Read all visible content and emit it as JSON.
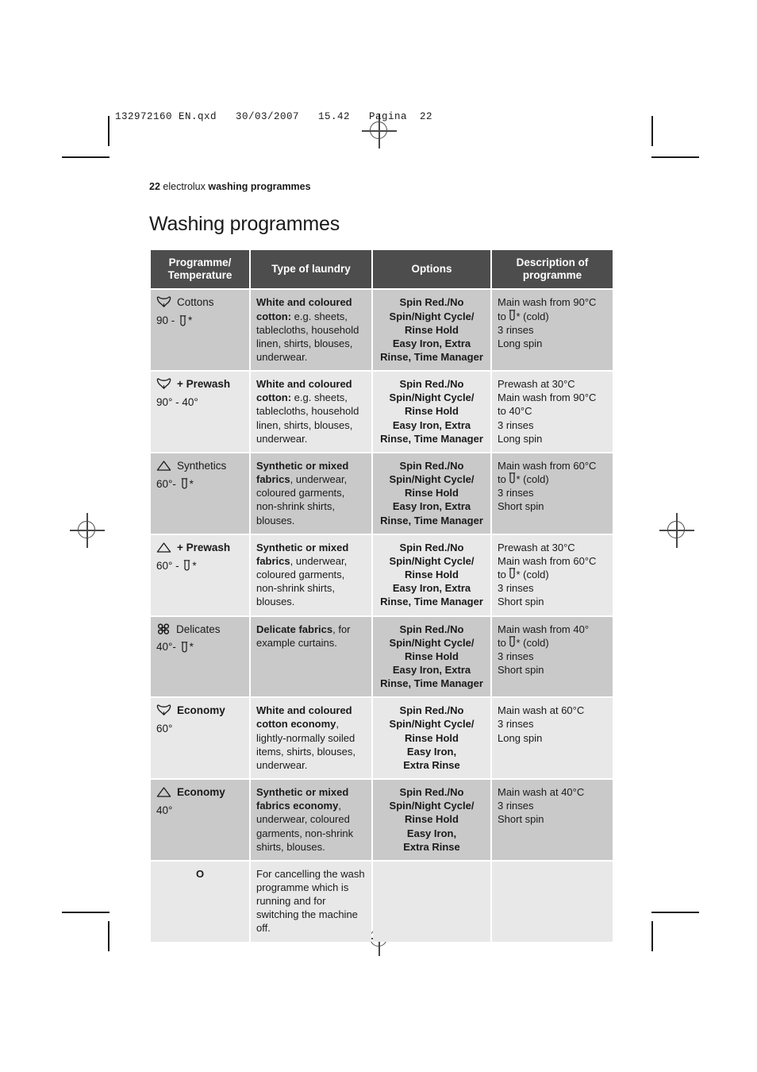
{
  "prepress": {
    "file_info": "132972160 EN.qxd   30/03/2007   15.42   Pagina  22"
  },
  "running_head": {
    "page_number": "22",
    "brand": "electrolux",
    "section": "washing programmes"
  },
  "page_title": "Washing programmes",
  "table": {
    "headers": [
      "Programme/\nTemperature",
      "Type of laundry",
      "Options",
      "Description of\nprogramme"
    ],
    "header_lines": {
      "col1_line1": "Programme/",
      "col1_line2": "Temperature",
      "col2": "Type of laundry",
      "col3": "Options",
      "col4_line1": "Description of",
      "col4_line2": "programme"
    },
    "rows": [
      {
        "shade": "dark",
        "icon": "cotton-icon",
        "programme": "Cottons",
        "programme_bold": false,
        "temperature_prefix": "90 - ",
        "temperature_icon": "thermometer-icon",
        "temperature_suffix": "*",
        "laundry_bold": "White and coloured cotton:",
        "laundry_rest": " e.g. sheets, tablecloths, household linen, shirts, blouses, underwear.",
        "options": "Spin Red./No Spin/Night Cycle/ Rinse Hold Easy Iron, Extra Rinse, Time Manager",
        "options_lines": [
          "Spin Red./No",
          "Spin/Night Cycle/",
          "Rinse Hold",
          "Easy Iron, Extra",
          "Rinse, Time Manager"
        ],
        "description_lines": [
          "Main wash from 90°C",
          "to [therm]* (cold)",
          "3 rinses",
          "Long spin"
        ],
        "desc_pre": "Main wash from 90°C",
        "desc_to_prefix": "to ",
        "desc_to_suffix": "* (cold)",
        "desc_tail": [
          "3 rinses",
          "Long spin"
        ]
      },
      {
        "shade": "light",
        "icon": "cotton-icon",
        "programme": "+ Prewash",
        "programme_bold": true,
        "temperature_prefix": "90° - 40°",
        "temperature_icon": "none",
        "temperature_suffix": "",
        "laundry_bold": "White and coloured cotton:",
        "laundry_rest": " e.g. sheets, tablecloths, household linen, shirts, blouses, underwear.",
        "options_lines": [
          "Spin Red./No",
          "Spin/Night Cycle/",
          "Rinse Hold",
          "Easy Iron, Extra",
          "Rinse, Time Manager"
        ],
        "desc_pre": "Prewash at 30°C\nMain wash from 90°C\nto 40°C",
        "desc_to_prefix": "",
        "desc_to_suffix": "",
        "desc_tail": [
          "3 rinses",
          "Long spin"
        ]
      },
      {
        "shade": "dark",
        "icon": "synthetics-icon",
        "programme": "Synthetics",
        "programme_bold": false,
        "temperature_prefix": "60°- ",
        "temperature_icon": "thermometer-icon",
        "temperature_suffix": "*",
        "laundry_bold": "Synthetic or mixed fabrics",
        "laundry_rest": ", underwear, coloured garments, non-shrink shirts, blouses.",
        "options_lines": [
          "Spin Red./No",
          "Spin/Night Cycle/",
          "Rinse Hold",
          "Easy Iron, Extra",
          "Rinse, Time Manager"
        ],
        "desc_pre": "Main wash from 60°C",
        "desc_to_prefix": "to ",
        "desc_to_suffix": "* (cold)",
        "desc_tail": [
          "3 rinses",
          "Short spin"
        ]
      },
      {
        "shade": "light",
        "icon": "synthetics-icon",
        "programme": "+ Prewash",
        "programme_bold": true,
        "temperature_prefix": "60° - ",
        "temperature_icon": "thermometer-icon",
        "temperature_suffix": "*",
        "laundry_bold": "Synthetic or mixed fabrics",
        "laundry_rest": ", underwear, coloured garments, non-shrink shirts, blouses.",
        "options_lines": [
          "Spin Red./No",
          "Spin/Night Cycle/",
          "Rinse Hold",
          "Easy Iron, Extra",
          "Rinse, Time Manager"
        ],
        "desc_pre": "Prewash at 30°C\nMain wash from 60°C",
        "desc_to_prefix": "to ",
        "desc_to_suffix": "* (cold)",
        "desc_tail": [
          "3 rinses",
          "Short spin"
        ]
      },
      {
        "shade": "dark",
        "icon": "delicates-icon",
        "programme": "Delicates",
        "programme_bold": false,
        "temperature_prefix": "40°- ",
        "temperature_icon": "thermometer-icon",
        "temperature_suffix": "*",
        "laundry_bold": "Delicate fabrics",
        "laundry_rest": ", for example curtains.",
        "options_lines": [
          "Spin Red./No",
          "Spin/Night Cycle/",
          "Rinse Hold",
          "Easy Iron, Extra",
          "Rinse, Time Manager"
        ],
        "desc_pre": "Main wash from 40°",
        "desc_to_prefix": "to ",
        "desc_to_suffix": "* (cold)",
        "desc_tail": [
          "3 rinses",
          "Short spin"
        ]
      },
      {
        "shade": "light",
        "icon": "cotton-icon",
        "programme": "Economy",
        "programme_bold": true,
        "temperature_prefix": "60°",
        "temperature_icon": "none",
        "temperature_suffix": "",
        "laundry_bold": "White and coloured cotton economy",
        "laundry_rest": ", lightly-normally soiled items, shirts, blouses, underwear.",
        "options_lines": [
          "Spin Red./No",
          "Spin/Night Cycle/",
          "Rinse Hold",
          "Easy Iron,",
          "Extra Rinse"
        ],
        "desc_pre": "Main wash at 60°C",
        "desc_to_prefix": "",
        "desc_to_suffix": "",
        "desc_tail": [
          "3 rinses",
          "Long spin"
        ]
      },
      {
        "shade": "dark",
        "icon": "synthetics-icon",
        "programme": "Economy",
        "programme_bold": true,
        "temperature_prefix": "40°",
        "temperature_icon": "none",
        "temperature_suffix": "",
        "laundry_bold": "Synthetic or mixed fabrics economy",
        "laundry_rest": ", underwear, coloured garments, non-shrink shirts, blouses.",
        "options_lines": [
          "Spin Red./No",
          "Spin/Night Cycle/",
          "Rinse Hold",
          "Easy Iron,",
          "Extra Rinse"
        ],
        "desc_pre": "Main wash at 40°C",
        "desc_to_prefix": "",
        "desc_to_suffix": "",
        "desc_tail": [
          "3 rinses",
          "Short spin"
        ]
      },
      {
        "shade": "light",
        "icon": "none",
        "programme": "O",
        "programme_bold": true,
        "temperature_prefix": "",
        "temperature_icon": "none",
        "temperature_suffix": "",
        "laundry_bold": "",
        "laundry_rest": "For cancelling the wash programme which is running and for switching the machine off.",
        "options_lines": [],
        "desc_pre": "",
        "desc_to_prefix": "",
        "desc_to_suffix": "",
        "desc_tail": []
      }
    ]
  },
  "colors": {
    "header_bg": "#4d4d4d",
    "row_dark": "#c9c9c9",
    "row_light": "#e8e8e8",
    "text": "#1a1a1a"
  }
}
